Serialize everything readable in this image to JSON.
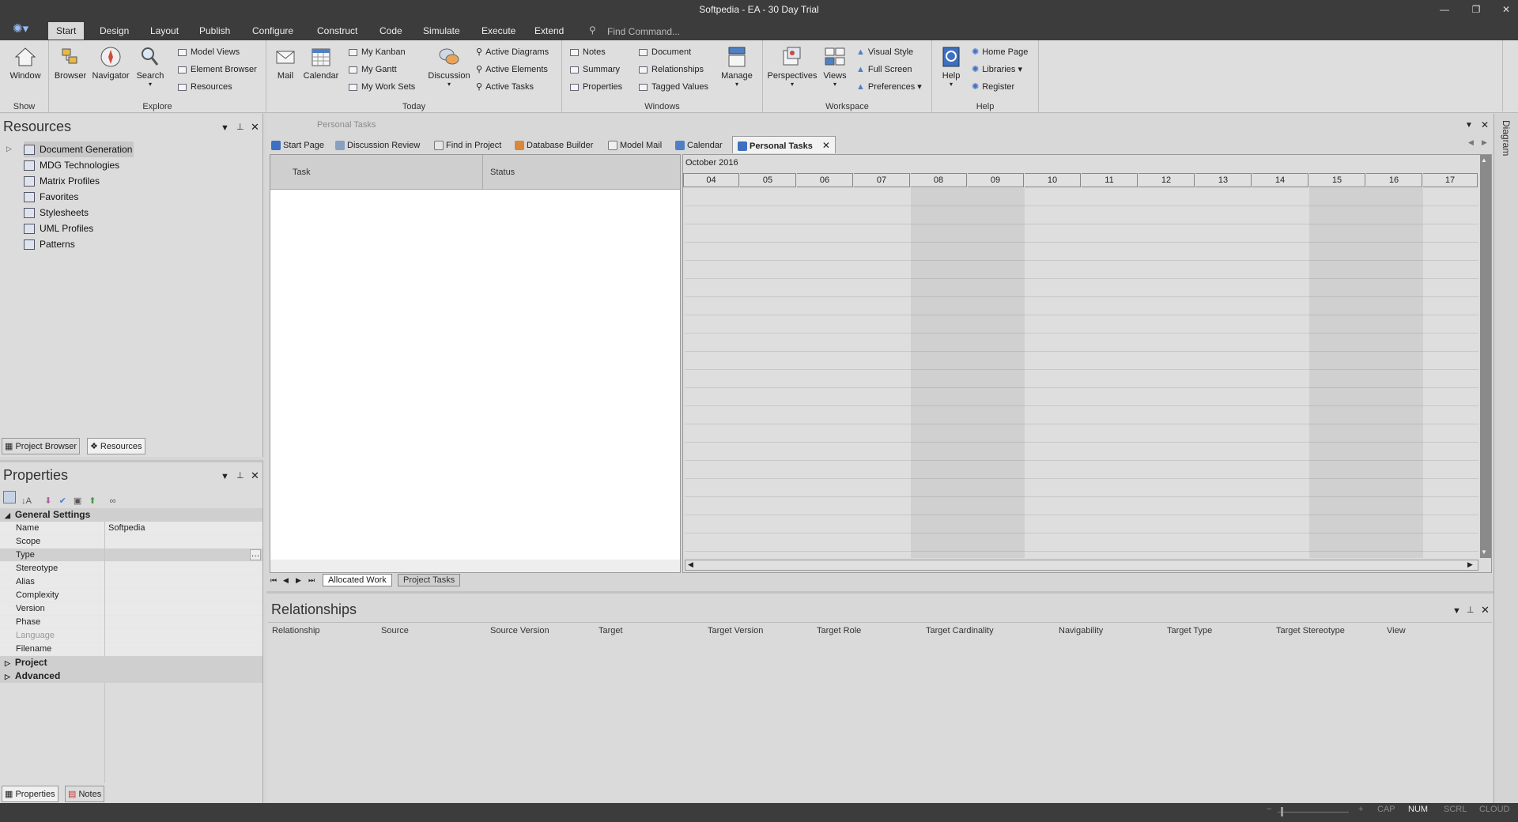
{
  "window": {
    "title": "Softpedia - EA - 30 Day Trial"
  },
  "menu": {
    "tabs": [
      "Start",
      "Design",
      "Layout",
      "Publish",
      "Configure",
      "Construct",
      "Code",
      "Simulate",
      "Execute",
      "Extend"
    ],
    "find_command": "Find Command..."
  },
  "ribbon": {
    "show": {
      "label": "Show",
      "window": "Window"
    },
    "explore": {
      "label": "Explore",
      "browser": "Browser",
      "navigator": "Navigator",
      "search": "Search",
      "model_views": "Model Views",
      "element_browser": "Element Browser",
      "resources": "Resources"
    },
    "today": {
      "label": "Today",
      "mail": "Mail",
      "calendar": "Calendar",
      "my_kanban": "My Kanban",
      "my_gantt": "My Gantt",
      "my_work_sets": "My Work Sets",
      "discussion": "Discussion",
      "active_diagrams": "Active Diagrams",
      "active_elements": "Active Elements",
      "active_tasks": "Active Tasks"
    },
    "windows": {
      "label": "Windows",
      "notes": "Notes",
      "summary": "Summary",
      "properties": "Properties",
      "document": "Document",
      "relationships": "Relationships",
      "tagged_values": "Tagged Values",
      "manage": "Manage"
    },
    "workspace": {
      "label": "Workspace",
      "perspectives": "Perspectives",
      "views": "Views",
      "visual_style": "Visual Style",
      "full_screen": "Full Screen",
      "preferences": "Preferences"
    },
    "help": {
      "label": "Help",
      "help": "Help",
      "home_page": "Home Page",
      "libraries": "Libraries",
      "register": "Register"
    }
  },
  "resources_panel": {
    "title": "Resources",
    "items": [
      "Document Generation",
      "MDG Technologies",
      "Matrix Profiles",
      "Favorites",
      "Stylesheets",
      "UML Profiles",
      "Patterns"
    ],
    "tabs": [
      "Project Browser",
      "Resources"
    ]
  },
  "properties_panel": {
    "title": "Properties",
    "general_settings": "General Settings",
    "rows": [
      {
        "key": "Name",
        "value": "Softpedia"
      },
      {
        "key": "Scope",
        "value": ""
      },
      {
        "key": "Type",
        "value": ""
      },
      {
        "key": "Stereotype",
        "value": ""
      },
      {
        "key": "Alias",
        "value": ""
      },
      {
        "key": "Complexity",
        "value": ""
      },
      {
        "key": "Version",
        "value": ""
      },
      {
        "key": "Phase",
        "value": ""
      },
      {
        "key": "Language",
        "value": ""
      },
      {
        "key": "Filename",
        "value": ""
      }
    ],
    "project": "Project",
    "advanced": "Advanced",
    "tabs": [
      "Properties",
      "Notes"
    ]
  },
  "document_area": {
    "caption": "Personal Tasks",
    "tabs": [
      "Start Page",
      "Discussion Review",
      "Find in Project",
      "Database Builder",
      "Model Mail",
      "Calendar",
      "Personal Tasks"
    ],
    "task_col": "Task",
    "status_col": "Status",
    "month": "October 2016",
    "days": [
      "04",
      "05",
      "06",
      "07",
      "08",
      "09",
      "10",
      "11",
      "12",
      "13",
      "14",
      "15",
      "16",
      "17"
    ],
    "bottom_tabs": [
      "Allocated Work",
      "Project Tasks"
    ]
  },
  "relationships_panel": {
    "title": "Relationships",
    "columns": [
      "Relationship",
      "Source",
      "Source Version",
      "Target",
      "Target Version",
      "Target Role",
      "Target Cardinality",
      "Navigability",
      "Target Type",
      "Target Stereotype",
      "View"
    ]
  },
  "right_sidebar": {
    "label": "Diagram"
  },
  "status_bar": {
    "items": [
      "CAP",
      "NUM",
      "SCRL",
      "CLOUD"
    ]
  },
  "colors": {
    "titlebar": "#3c3c3c",
    "ribbon": "#dedede",
    "accent": "#2b5fb4"
  }
}
